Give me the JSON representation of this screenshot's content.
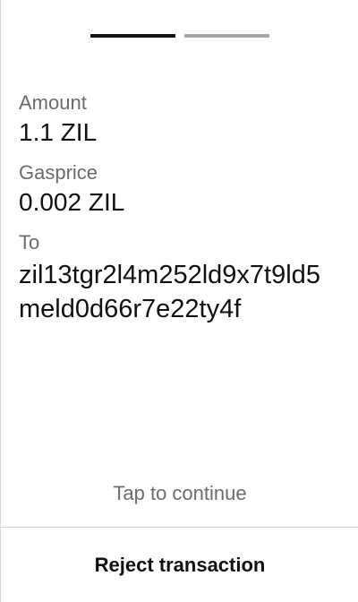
{
  "pager": {
    "total_steps": 2,
    "current_step": 1
  },
  "details": {
    "amount_label": "Amount",
    "amount_value": "1.1 ZIL",
    "gasprice_label": "Gasprice",
    "gasprice_value": "0.002 ZIL",
    "to_label": "To",
    "to_value": "zil13tgr2l4m252ld9x7t9ld5meld0d66r7e22ty4f"
  },
  "footer": {
    "tap_to_continue": "Tap to continue",
    "reject_label": "Reject transaction"
  },
  "colors": {
    "primary_text": "#111111",
    "secondary_text": "#6b6b6b",
    "active_step": "#111111",
    "inactive_step": "#a8a8a8"
  }
}
